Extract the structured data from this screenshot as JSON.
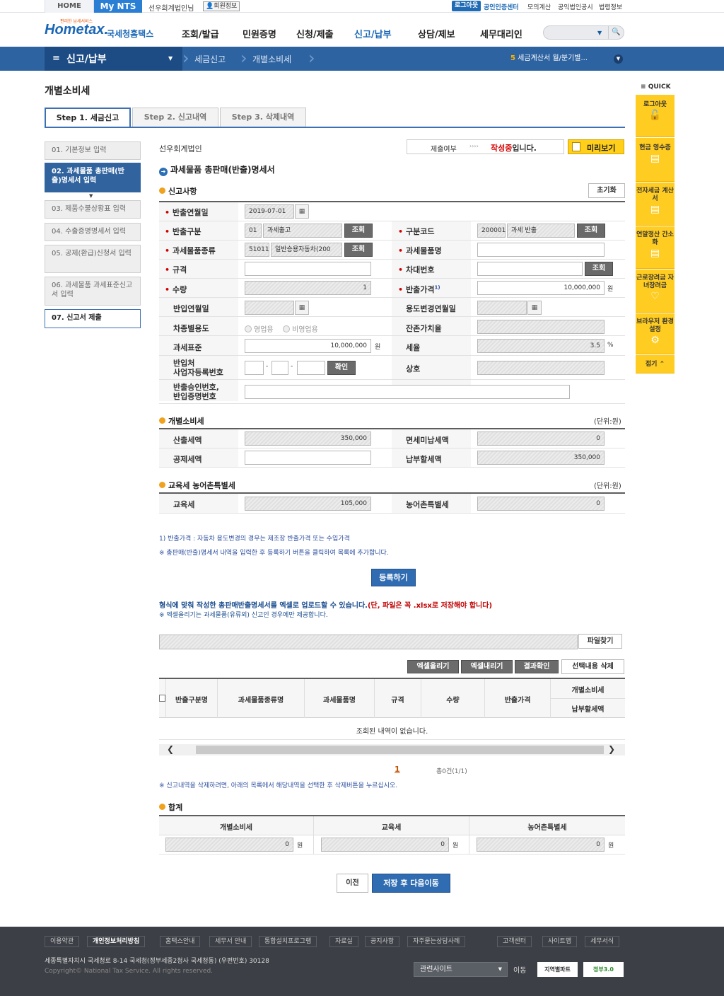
{
  "util": {
    "home": "HOME",
    "mynts": "My NTS",
    "user": "선우회계법인님",
    "member_info": "회원정보",
    "logout": "로그아웃",
    "cert_center": "공인인증센터",
    "mock_calc": "모의계산",
    "corp_notice": "공익법인공시",
    "law_info": "법령정보"
  },
  "header": {
    "logo_small": "편리한 납세서비스",
    "logo_main": "Hometax.",
    "logo_kr": "국세청홈택스",
    "gnb": [
      "조회/발급",
      "민원증명",
      "신청/제출",
      "신고/납부",
      "상담/제보",
      "세무대리인"
    ]
  },
  "nav": {
    "section": "신고/납부",
    "breadcrumb": [
      "세금신고",
      "개별소비세"
    ],
    "notice_num": "5",
    "notice_text": "세금계산서 월/분기별..."
  },
  "page": {
    "title": "개별소비세",
    "steps": [
      "Step 1. 세금신고",
      "Step 2. 신고내역",
      "Step 3. 삭제내역"
    ]
  },
  "left_menu": [
    "01. 기본정보 입력",
    "02. 과세물품 총판매(반출)명세서 입력",
    "03. 제품수불상황표 입력",
    "04. 수출증명명세서 입력",
    "05. 공제(환급)신청서 입력",
    "06. 과세물품 과세표준신고서 입력",
    "07. 신고서 제출"
  ],
  "status": {
    "corp_name": "선우회계법인",
    "submit_label": "제출여부",
    "arrows": "››››",
    "state_red": "작성중",
    "state_suffix": "입니다.",
    "preview": "미리보기"
  },
  "section_main": "과세물품 총판매(반출)명세서",
  "report": {
    "title": "신고사항",
    "reset": "초기화",
    "lookup": "조회",
    "won": "원",
    "pct": "%",
    "confirm": "확인",
    "fields": {
      "release_ym_label": "반출연월일",
      "release_ym": "2019-07-01",
      "release_type_label": "반출구분",
      "release_type_code": "01",
      "release_type_name": "과세출고",
      "class_code_label": "구분코드",
      "class_code": "200001",
      "class_code_name": "과세 반출",
      "item_type_label": "과세물품종류",
      "item_type_code": "51011",
      "item_type_name": "일반승용자동차(200",
      "item_name_label": "과세물품명",
      "spec_label": "규격",
      "vehicle_no_label": "차대번호",
      "qty_label": "수량",
      "qty": "1",
      "price_label": "반출가격",
      "price_sup": "1)",
      "price": "10,000,000",
      "import_ym_label": "반입연월일",
      "use_change_label": "용도변경연월일",
      "vehicle_use_label": "차종별용도",
      "use_opt1": "영업용",
      "use_opt2": "비영업용",
      "residual_label": "잔존가치율",
      "tax_base_label": "과세표준",
      "tax_base": "10,000,000",
      "tax_rate_label": "세율",
      "tax_rate": "3.5",
      "biz_no_label_1": "반입처",
      "biz_no_label_2": "사업자등록번호",
      "trade_name_label": "상호",
      "approval_label_1": "반출승인번호,",
      "approval_label_2": "반입증명번호"
    }
  },
  "excise": {
    "title": "개별소비세",
    "unit": "(단위:원)",
    "calc_tax_label": "산출세액",
    "calc_tax": "350,000",
    "exempt_label": "면세미납세액",
    "exempt": "0",
    "deduct_label": "공제세액",
    "payable_label": "납부할세액",
    "payable": "350,000"
  },
  "edu": {
    "title": "교육세 농어촌특별세",
    "unit": "(단위:원)",
    "edu_label": "교육세",
    "edu": "105,000",
    "rural_label": "농어촌특별세",
    "rural": "0"
  },
  "notes": {
    "n1": "1) 반출가격 : 자동차 용도변경의 경우는 제조장 반출가격 또는 수입가격",
    "n2": "※ 총판매(반출)명세서 내역을 입력한 후 등록하기 버튼을 클릭하여 목록에 추가합니다.",
    "register": "등록하기",
    "excel_1": "형식에 맞춰 작성한 총판매반출명세서를 엑셀로 업로드할 수 있습니다.",
    "excel_2": "(단, 파일은 꼭 .xlsx로 저장해야 합니다)",
    "excel_3": "※ 엑셀올리기는 과세물품(유류외) 신고인 경우에만 제공합니다.",
    "file_find": "파일찾기"
  },
  "list": {
    "buttons": [
      "엑셀올리기",
      "엑셀내리기",
      "결과확인",
      "선택내용 삭제"
    ],
    "headers": [
      "반출구분명",
      "과세물품종류명",
      "과세물품명",
      "규격",
      "수량",
      "반출가격",
      "개별소비세",
      "납부할세액"
    ],
    "empty": "조회된 내역이 없습니다.",
    "page": "1",
    "total": "총0건(1/1)",
    "delete_note": "※ 신고내역을 삭제하려면, 아래의 목록에서 해당내역을 선택한 후 삭제버튼을 누르십시오."
  },
  "total": {
    "title": "합계",
    "headers": [
      "개별소비세",
      "교육세",
      "농어촌특별세"
    ],
    "values": [
      "0",
      "0",
      "0"
    ],
    "won": "원"
  },
  "bottom_buttons": {
    "prev": "이전",
    "next": "저장 후 다음이동"
  },
  "quick": {
    "title": "QUICK",
    "items": [
      "로그아웃",
      "현금 영수증",
      "전자세금 계산서",
      "연말정산 간소화",
      "근로장려금 자녀장려금",
      "브라우저 환경설정"
    ],
    "fold": "접기"
  },
  "footer": {
    "links": [
      "이용약관",
      "개인정보처리방침",
      "홈택스안내",
      "세무서 안내",
      "통합설치프로그램",
      "자료실",
      "공지사항",
      "자주묻는상담사례"
    ],
    "right_links": [
      "고객센터",
      "사이트맵",
      "세무서식"
    ],
    "address": "세종특별자치시 국세청로 8-14 국세청(정부세종2청사 국세청동) (우편번호) 30128",
    "copyright": "Copyright© National Tax Service. All rights reserved.",
    "related": "관련사이트",
    "go": "이동",
    "badge1": "지역별파트",
    "badge2": "정부3.0"
  }
}
